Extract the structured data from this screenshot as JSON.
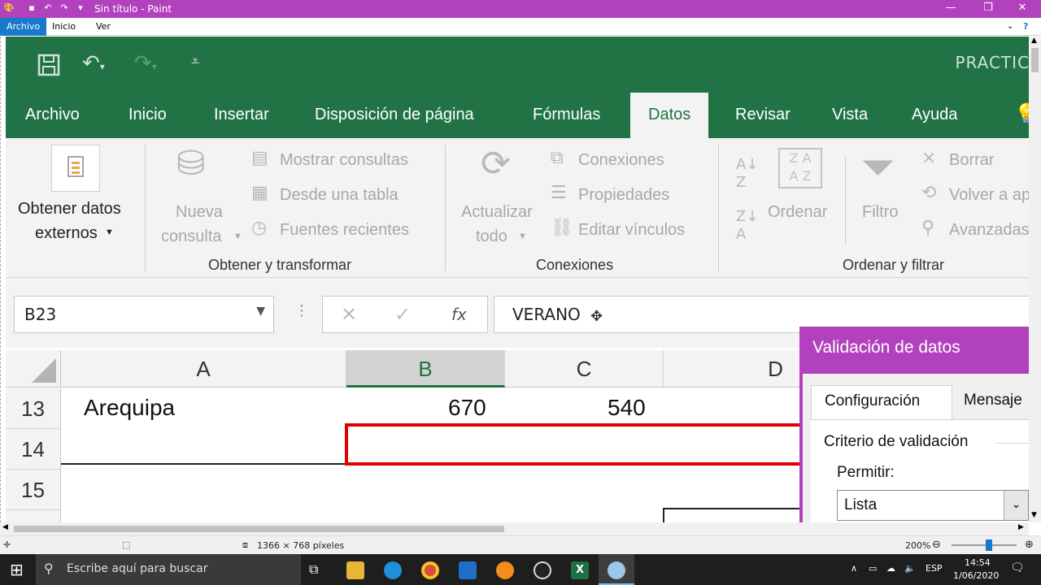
{
  "paint": {
    "title": "Sin título - Paint",
    "menu": [
      "Archivo",
      "Inicio",
      "Ver"
    ],
    "status_size": "1366 × 768 píxeles",
    "zoom": "200%"
  },
  "excel": {
    "doc_name": "PRACTIC",
    "tabs": [
      "Archivo",
      "Inicio",
      "Insertar",
      "Disposición de página",
      "Fórmulas",
      "Datos",
      "Revisar",
      "Vista",
      "Ayuda"
    ],
    "active_tab": "Datos",
    "ribbon": {
      "get_data_l1": "Obtener datos",
      "get_data_l2": "externos",
      "new_query_l1": "Nueva",
      "new_query_l2": "consulta",
      "show_queries": "Mostrar consultas",
      "from_table": "Desde una tabla",
      "recent_sources": "Fuentes recientes",
      "group_transform": "Obtener y transformar",
      "refresh_l1": "Actualizar",
      "refresh_l2": "todo",
      "connections": "Conexiones",
      "properties": "Propiedades",
      "edit_links": "Editar vínculos",
      "group_connections": "Conexiones",
      "sort": "Ordenar",
      "filter": "Filtro",
      "clear": "Borrar",
      "reapply": "Volver a ap",
      "advanced": "Avanzadas",
      "group_sort": "Ordenar y filtrar"
    },
    "name_box": "B23",
    "formula": "VERANO",
    "columns": [
      "A",
      "B",
      "C",
      "D"
    ],
    "rows": [
      {
        "num": "13",
        "a": "Arequipa",
        "b": "670",
        "c": "540"
      },
      {
        "num": "14",
        "a": "",
        "b": "",
        "c": ""
      },
      {
        "num": "15",
        "a": "",
        "b": "",
        "c": ""
      }
    ]
  },
  "dialog": {
    "title": "Validación de datos",
    "tab_config": "Configuración",
    "tab_msg": "Mensaje",
    "criteria": "Criterio de validación",
    "allow_label": "Permitir:",
    "allow_value": "Lista"
  },
  "taskbar": {
    "search_placeholder": "Escribe aquí para buscar",
    "lang": "ESP",
    "time": "14:54",
    "date": "1/06/2020"
  },
  "colors": {
    "excel_green": "#217346",
    "paint_purple": "#b241bd",
    "selection_red": "#e00000"
  }
}
